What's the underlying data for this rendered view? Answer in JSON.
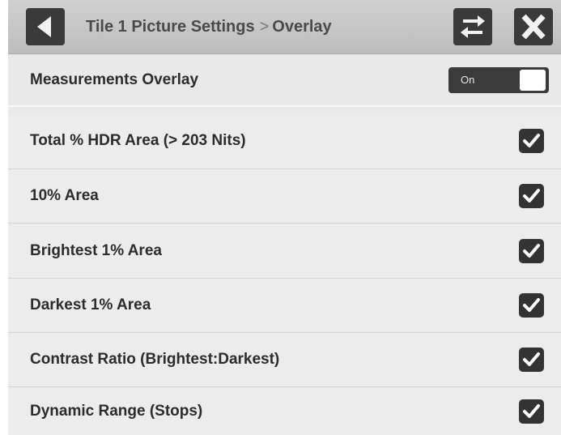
{
  "header": {
    "title": "Tile 1 Picture Settings",
    "separator": ">",
    "current": "Overlay",
    "back_icon": "back-arrow-icon",
    "swap_icon": "swap-arrows-icon",
    "close_icon": "close-x-icon"
  },
  "measurements_overlay": {
    "label": "Measurements Overlay",
    "toggle_text": "On",
    "enabled": true
  },
  "options": [
    {
      "label": "Total % HDR Area (> 203 Nits)",
      "checked": true
    },
    {
      "label": "10% Area",
      "checked": true
    },
    {
      "label": "Brightest 1% Area",
      "checked": true
    },
    {
      "label": "Darkest 1% Area",
      "checked": true
    },
    {
      "label": "Contrast Ratio (Brightest:Darkest)",
      "checked": true
    },
    {
      "label": "Dynamic Range (Stops)",
      "checked": true
    }
  ],
  "colors": {
    "header_bg": "#c6c6c6",
    "row_bg": "#ececec",
    "control_dark": "#333333",
    "text": "#2c2c2c"
  }
}
